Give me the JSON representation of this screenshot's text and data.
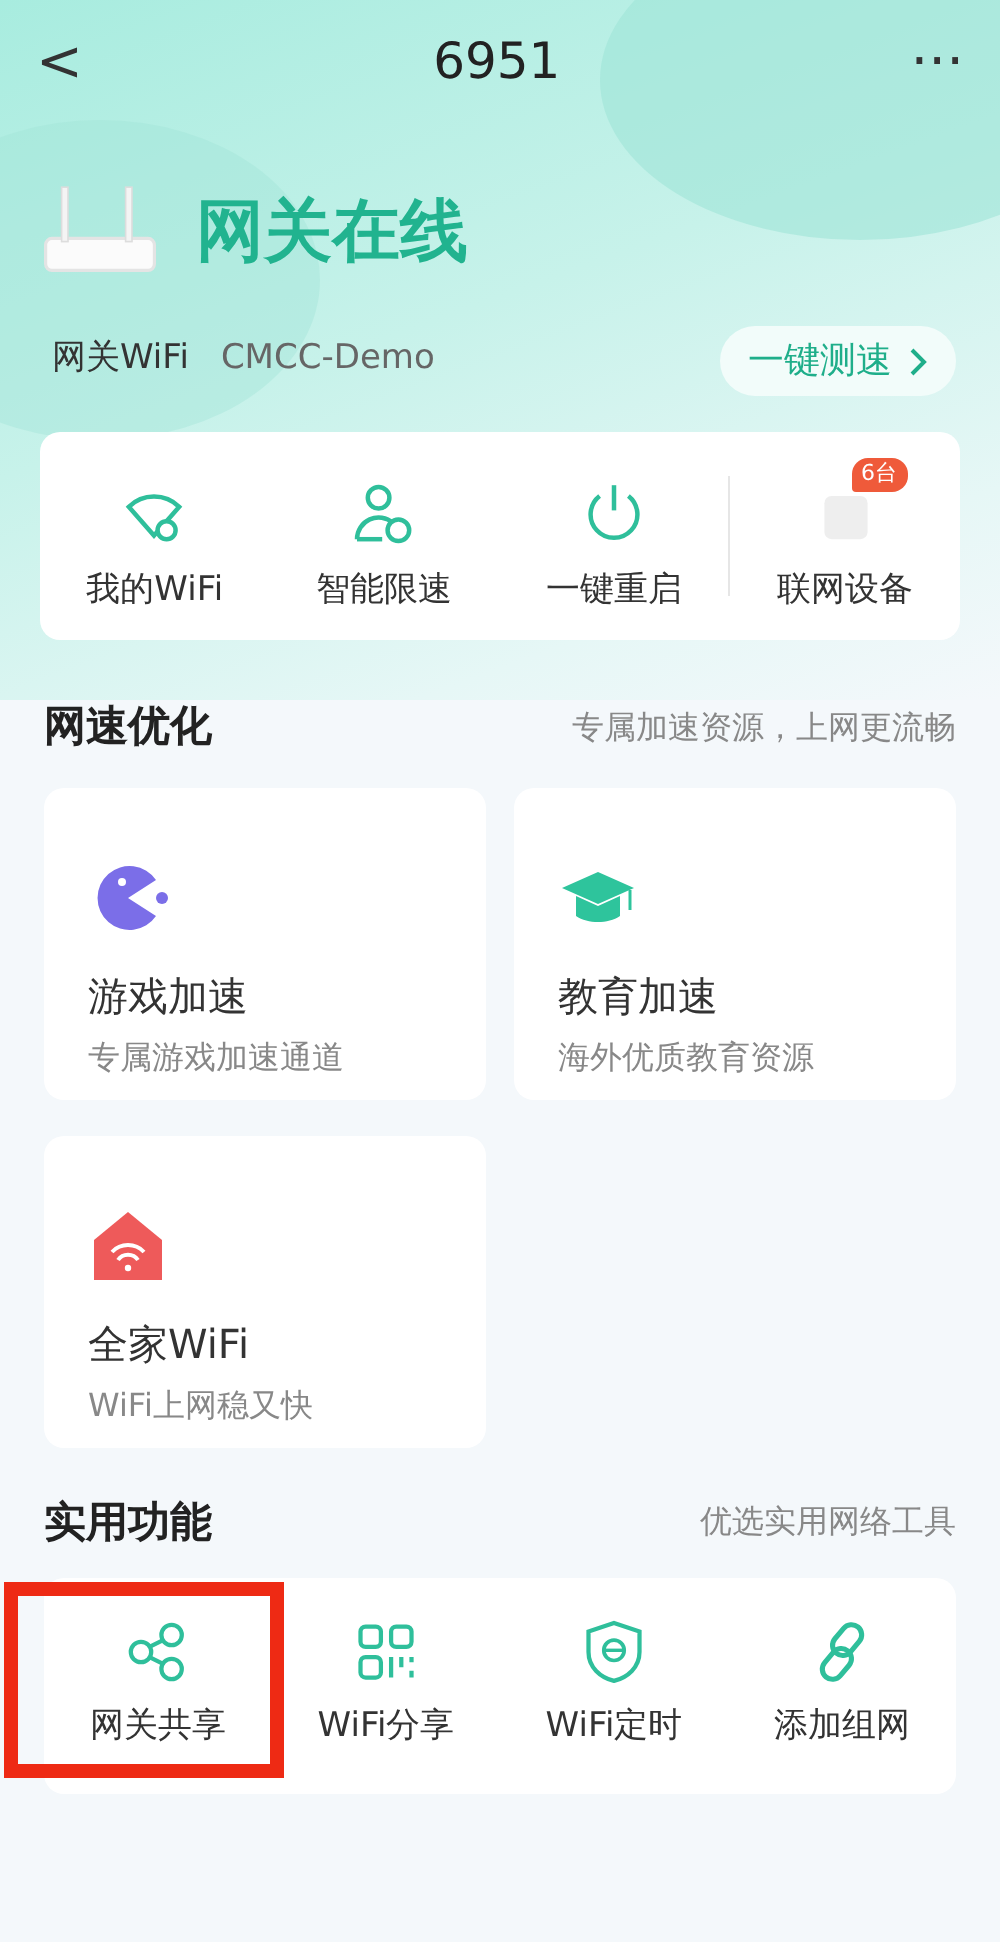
{
  "nav": {
    "back": "<",
    "title": "6951",
    "more": "···"
  },
  "gateway": {
    "status": "网关在线",
    "wifi_label": "网关WiFi",
    "wifi_name": "CMCC-Demo",
    "speed_test": "一键测速"
  },
  "quick_actions": [
    {
      "kind": "wifi",
      "label": "我的WiFi"
    },
    {
      "kind": "user",
      "label": "智能限速"
    },
    {
      "kind": "power",
      "label": "一键重启"
    },
    {
      "kind": "device",
      "label": "联网设备",
      "badge": "6台"
    }
  ],
  "speed_section": {
    "title": "网速优化",
    "subtitle": "专属加速资源，上网更流畅"
  },
  "speed_cards": [
    {
      "kind": "game",
      "title": "游戏加速",
      "desc": "专属游戏加速通道"
    },
    {
      "kind": "edu",
      "title": "教育加速",
      "desc": "海外优质教育资源"
    },
    {
      "kind": "home",
      "title": "全家WiFi",
      "desc": "WiFi上网稳又快"
    }
  ],
  "tools_section": {
    "title": "实用功能",
    "subtitle": "优选实用网络工具"
  },
  "tools": [
    {
      "kind": "share",
      "label": "网关共享",
      "highlighted": true
    },
    {
      "kind": "qr",
      "label": "WiFi分享",
      "highlighted": false
    },
    {
      "kind": "shield",
      "label": "WiFi定时",
      "highlighted": false
    },
    {
      "kind": "link",
      "label": "添加组网",
      "highlighted": false
    }
  ]
}
